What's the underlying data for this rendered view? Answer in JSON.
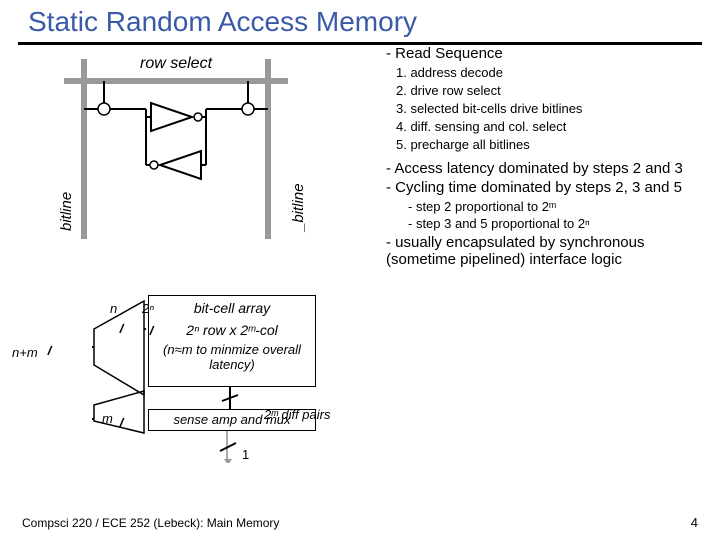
{
  "title": "Static Random Access Memory",
  "diagram": {
    "row_select": "row select",
    "bitline": "bitline",
    "bitline_bar": "_bitline",
    "bitcell_array": "bit-cell array",
    "array_spec": "2ⁿ row x 2ᵐ-col",
    "array_note": "(n≈m to minmize overall latency)",
    "sense_amp": "sense amp and mux",
    "diff_pairs": "2ᵐ diff pairs",
    "n": "n",
    "nm": "n+m",
    "m": "m",
    "two_n": "2ⁿ",
    "one": "1"
  },
  "read_seq": {
    "heading": "- Read Sequence",
    "items": [
      "1. address decode",
      "2. drive row select",
      "3. selected bit-cells drive bitlines",
      "4. diff. sensing and col. select",
      "5. precharge all bitlines"
    ]
  },
  "notes": {
    "n1": "- Access latency dominated by steps 2 and 3",
    "n2": "- Cycling time dominated by steps 2, 3 and 5",
    "s1": "- step 2 proportional to 2ᵐ",
    "s2": "- step 3 and 5 proportional to 2ⁿ",
    "n3": "- usually encapsulated by synchronous (sometime pipelined) interface logic"
  },
  "footer": "Compsci 220 / ECE 252 (Lebeck): Main Memory",
  "page": "4"
}
